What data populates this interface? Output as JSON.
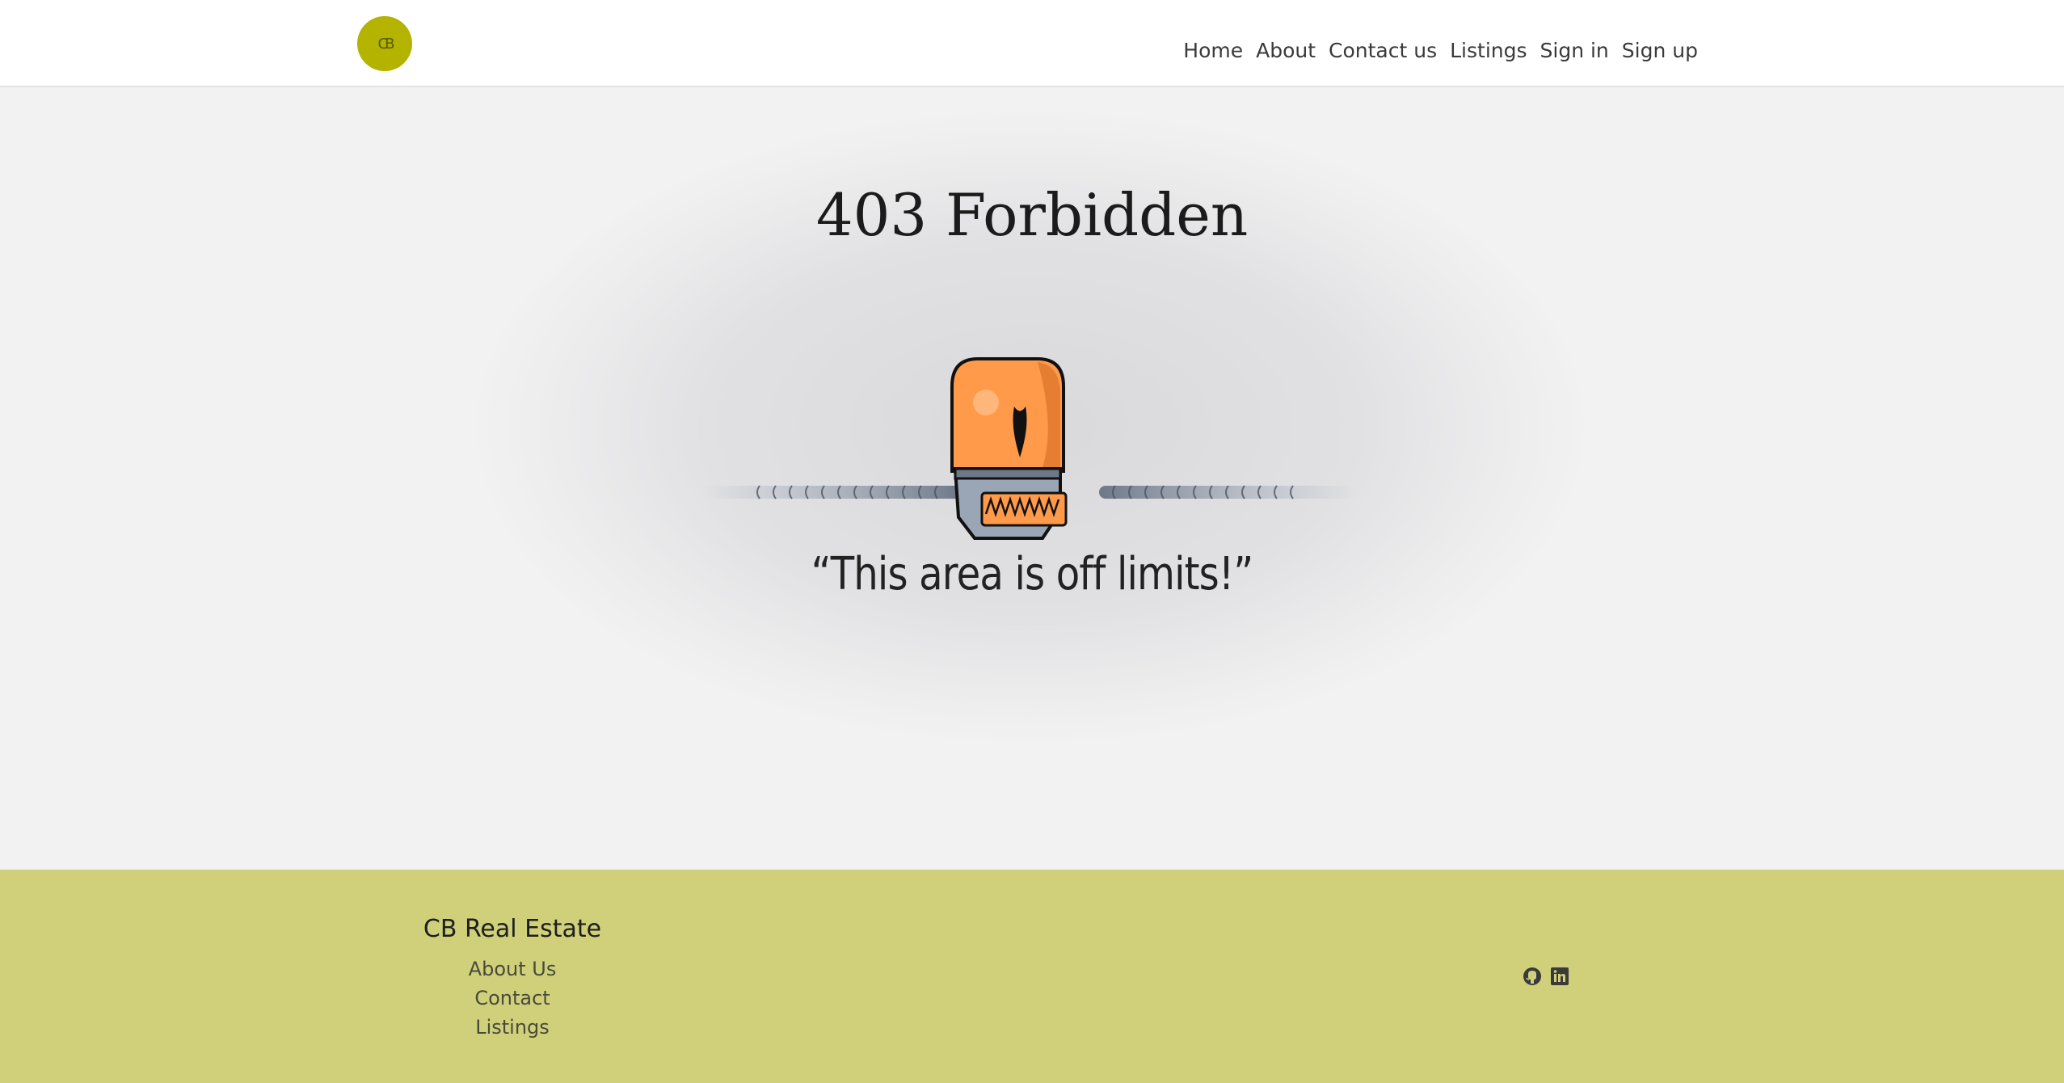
{
  "header": {
    "logo_text": "CB",
    "nav": [
      "Home",
      "About",
      "Contact us",
      "Listings",
      "Sign in",
      "Sign up"
    ]
  },
  "error": {
    "title": "403 Forbidden",
    "quote": "“This area is off limits!”"
  },
  "footer": {
    "title": "CB Real Estate",
    "links": [
      "About Us",
      "Contact",
      "Listings"
    ],
    "social_icons": [
      "github-icon",
      "linkedin-icon"
    ]
  },
  "colors": {
    "brand": "#b3b300",
    "footer_bg": "#d0d07a",
    "robot_orange": "#ff9a4a",
    "robot_steel": "#9aa5b6"
  }
}
